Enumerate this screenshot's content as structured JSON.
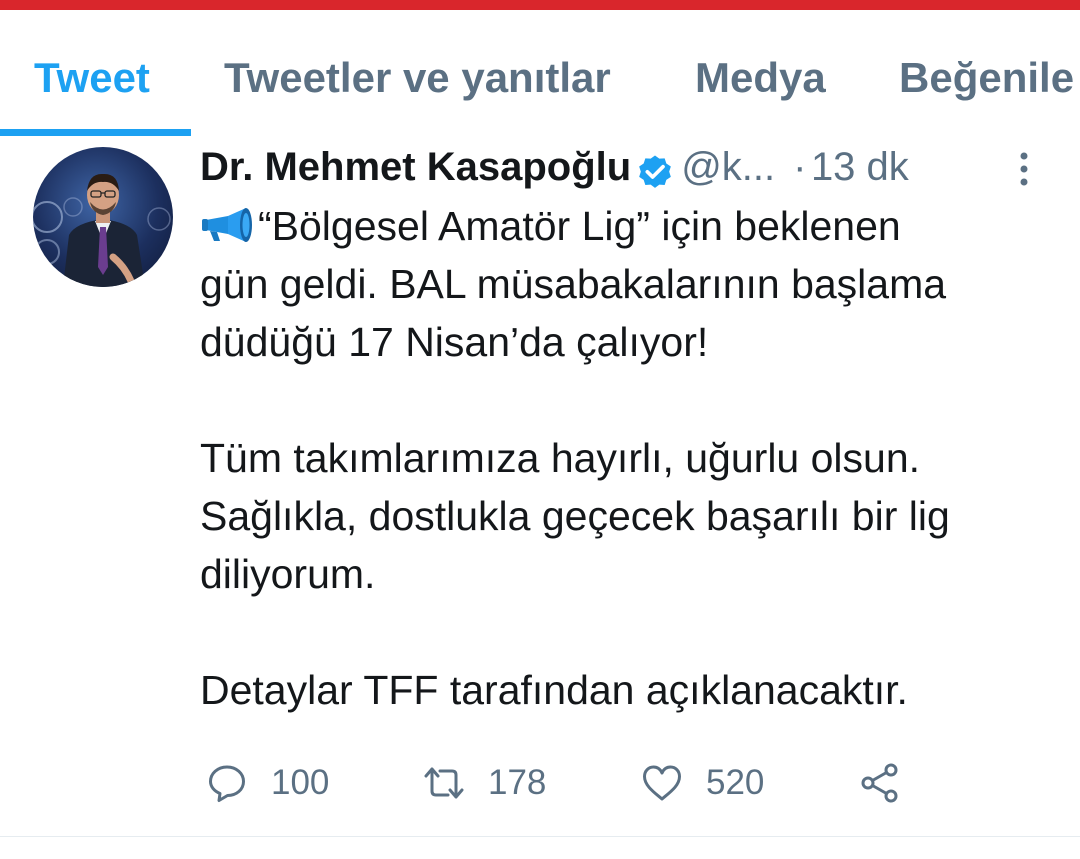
{
  "colors": {
    "accent": "#1da1f2",
    "top_strip": "#d9262c",
    "text_primary": "#14171a",
    "text_secondary": "#5b7083",
    "megaphone": "#1f8fe0"
  },
  "tabs": [
    {
      "label": "Tweet",
      "active": true
    },
    {
      "label": "Tweetler ve yanıtlar",
      "active": false
    },
    {
      "label": "Medya",
      "active": false
    },
    {
      "label": "Beğenile",
      "active": false
    }
  ],
  "tweet": {
    "author": {
      "name": "Dr. Mehmet Kasapoğlu",
      "verified": true,
      "handle": "@k...",
      "avatar": "profile-photo"
    },
    "separator": "·",
    "time": "13 dk",
    "text": {
      "emoji": "megaphone",
      "line1": "“Bölgesel Amatör Lig” için beklenen",
      "line2": "gün geldi. BAL müsabakalarının başlama",
      "line3": "düdüğü 17 Nisan’da çalıyor!",
      "line4": "Tüm takımlarımıza hayırlı, uğurlu olsun.",
      "line5": "Sağlıkla, dostlukla geçecek başarılı bir lig",
      "line6": "diliyorum.",
      "line7": "Detaylar TFF tarafından açıklanacaktır."
    },
    "actions": {
      "reply": {
        "icon": "reply-icon",
        "count": "100"
      },
      "retweet": {
        "icon": "retweet-icon",
        "count": "178"
      },
      "like": {
        "icon": "heart-icon",
        "count": "520"
      },
      "share": {
        "icon": "share-icon"
      }
    }
  }
}
